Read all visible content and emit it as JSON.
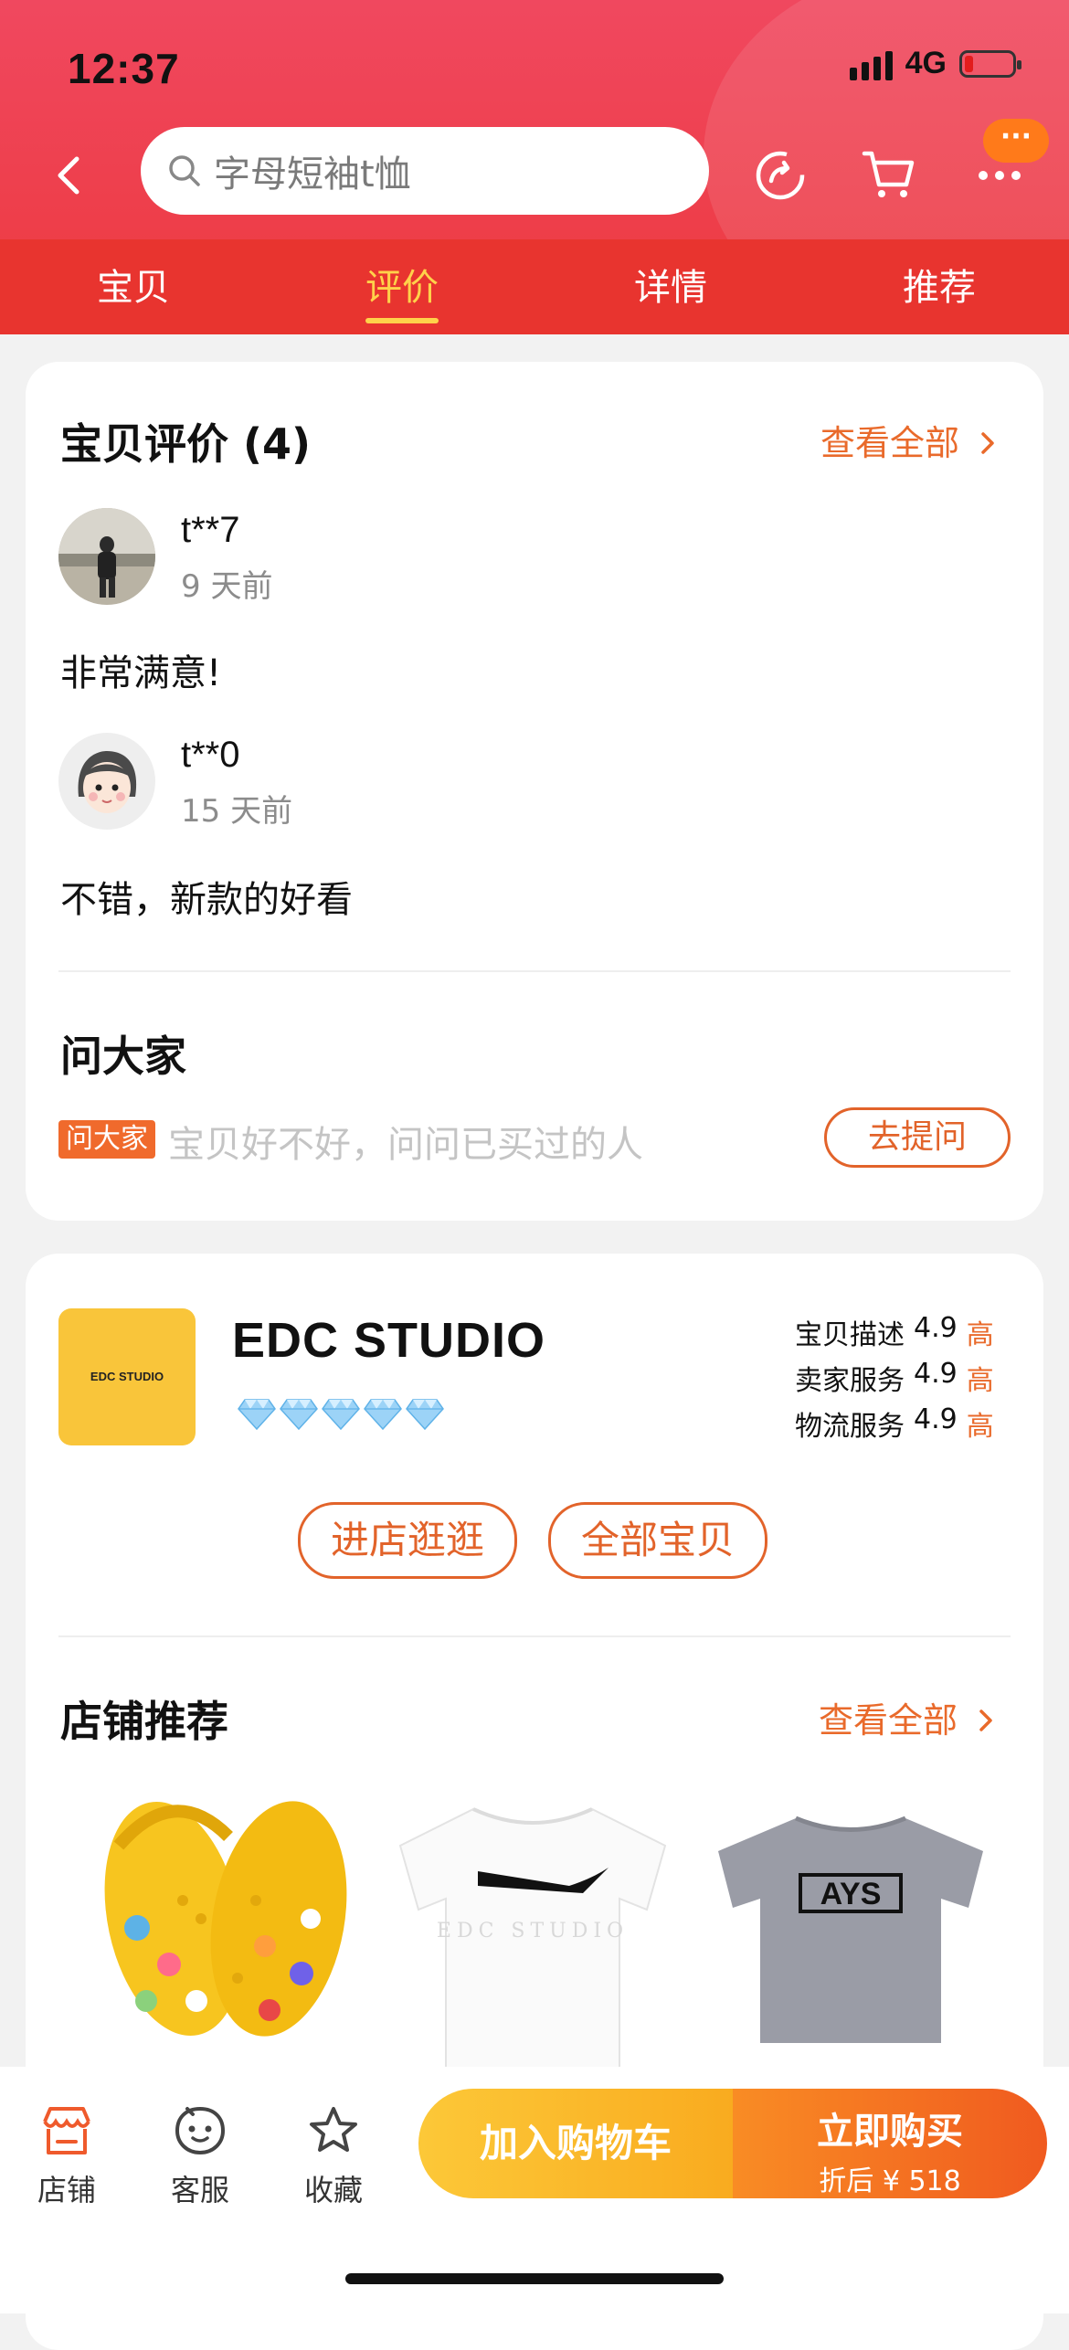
{
  "status_bar": {
    "time": "12:37",
    "network": "4G"
  },
  "header": {
    "search_placeholder": "字母短袖t恤",
    "more_badge": "···"
  },
  "tabs": [
    {
      "label": "宝贝"
    },
    {
      "label": "评价"
    },
    {
      "label": "详情"
    },
    {
      "label": "推荐"
    }
  ],
  "reviews": {
    "title": "宝贝评价 (4)",
    "view_all": "查看全部",
    "items": [
      {
        "user": "t**7",
        "time": "9 天前",
        "text": "非常满意!"
      },
      {
        "user": "t**0",
        "time": "15 天前",
        "text": "不错，新款的好看"
      }
    ]
  },
  "ask": {
    "title": "问大家",
    "tag": "问大家",
    "placeholder": "宝贝好不好，问问已买过的人",
    "button": "去提问"
  },
  "shop": {
    "logo_text": "EDC STUDIO",
    "name": "EDC STUDIO",
    "diamond_count": 5,
    "ratings": [
      {
        "label": "宝贝描述",
        "score": "4.9",
        "level": "高"
      },
      {
        "label": "卖家服务",
        "score": "4.9",
        "level": "高"
      },
      {
        "label": "物流服务",
        "score": "4.9",
        "level": "高"
      }
    ],
    "enter_button": "进店逛逛",
    "all_button": "全部宝贝",
    "recommend_title": "店铺推荐",
    "recommend_more": "查看全部",
    "products": [
      {
        "name": "yellow-clogs"
      },
      {
        "name": "white-tee",
        "print": "EDC STUDIO"
      },
      {
        "name": "gray-tee",
        "print": "AYS"
      }
    ]
  },
  "bottom_bar": {
    "shop": "店铺",
    "service": "客服",
    "favorite": "收藏",
    "add_to_cart": "加入购物车",
    "buy_now": "立即购买",
    "price": "折后 ¥ 518"
  },
  "colors": {
    "header_red": "#ee3f4c",
    "tab_bar_red": "#e8342f",
    "active_tab": "#ffd24a",
    "accent_orange": "#e96a2b"
  }
}
